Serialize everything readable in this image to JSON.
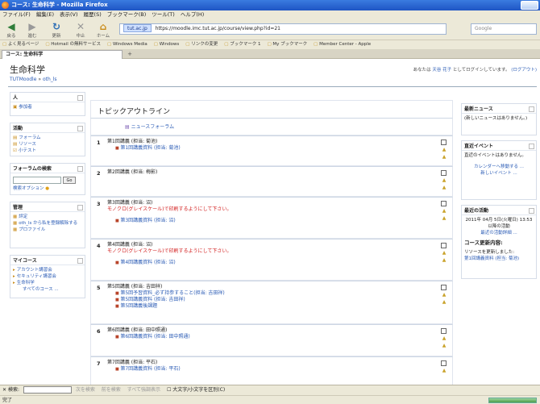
{
  "browser": {
    "title": "コース: 生命科学 - Mozilla Firefox",
    "menu": [
      "ファイル(F)",
      "編集(E)",
      "表示(V)",
      "履歴(S)",
      "ブックマーク(B)",
      "ツール(T)",
      "ヘルプ(H)"
    ],
    "nav": {
      "back": "戻る",
      "forward": "進む",
      "reload": "更新",
      "stop": "中止",
      "home": "ホーム"
    },
    "url_site": "tut.ac.jp",
    "url": "https://moodle.imc.tut.ac.jp/course/view.php?id=21",
    "search_placeholder": "Google",
    "bookmarks": [
      "よく見るページ",
      "Hotmail の無料サービス",
      "Windows Media",
      "Windows",
      "リンクの変更",
      "ブックマーク 1",
      "My ブックマーク",
      "Member Center - Apple"
    ],
    "tab_title": "コース: 生命科学"
  },
  "header": {
    "course_title": "生命科学",
    "login_prefix": "あなたは",
    "user": "天谷 花子",
    "login_suffix": "としてログインしています。",
    "logout": "(ログアウト)"
  },
  "breadcrumb": {
    "root": "TUTMoodle",
    "sep": "»",
    "current": "oth_ls"
  },
  "left": {
    "people": {
      "title": "人",
      "items": [
        "参加者"
      ]
    },
    "activities": {
      "title": "活動",
      "items": [
        "フォーラム",
        "リソース",
        "小テスト"
      ]
    },
    "forum_search": {
      "title": "フォーラムの検索",
      "go": "Go",
      "advanced": "検索オプション"
    },
    "admin": {
      "title": "管理",
      "items": [
        "評定",
        "oth_ls から私を登録解除する",
        "プロファイル"
      ]
    },
    "mycourses": {
      "title": "マイコース",
      "items": [
        "アカウント講習会",
        "セキュリティ講習会",
        "生命科学"
      ],
      "all": "すべてのコース ..."
    }
  },
  "center": {
    "heading": "トピックアウトライン",
    "forum": "ニュースフォーラム",
    "sections": [
      {
        "num": "1",
        "name": "第1回講義 (担当: 菊池)",
        "warn": "",
        "links": [
          "第1回講義資料 (担当: 菊池)"
        ]
      },
      {
        "num": "2",
        "name": "第2回講義 (担当: 梅影)",
        "warn": "",
        "links": []
      },
      {
        "num": "3",
        "name": "第3回講義 (担当: 沼)",
        "warn": "モノクロ(グレイスケール)で印刷するようにして下さい。",
        "links": [
          "第3回講義資料 (担当: 沼)"
        ]
      },
      {
        "num": "4",
        "name": "第4回講義 (担当: 沼)",
        "warn": "モノクロ(グレイスケール)で印刷するようにして下さい。",
        "links": [
          "第4回講義資料 (担当: 沼)"
        ]
      },
      {
        "num": "5",
        "name": "第5回講義 (担当: 吉田祥)",
        "warn": "",
        "links": [
          "第5回予習資料_必ず持参すること(担当: 吉田祥)",
          "第5回講義資料 (担当: 吉田祥)",
          "第5回講義後課題"
        ]
      },
      {
        "num": "6",
        "name": "第6回講義 (担当: 田中照通)",
        "warn": "",
        "links": [
          "第6回講義資料 (担当: 田中照通)"
        ]
      },
      {
        "num": "7",
        "name": "第7回講義 (担当: 平石)",
        "warn": "",
        "links": [
          "第7回講義資料 (担当: 平石)"
        ]
      }
    ]
  },
  "right": {
    "news": {
      "title": "最新ニュース",
      "body": "(新しいニュースはありません。)"
    },
    "events": {
      "title": "直近イベント",
      "body": "直近のイベントはありません。",
      "calendar": "カレンダーへ移動する ...",
      "new_event": "新しいイベント ..."
    },
    "recent": {
      "title": "最近の活動",
      "date": "2011年 04月 5日(火曜日) 13:53 以降の活動",
      "full": "最近の活動詳細 ...",
      "updates_title": "コース更新内容:",
      "updated": "リソースを更新しました:",
      "link": "第1回講義資料 (担当: 菊池)"
    }
  },
  "findbar": {
    "label": "検索:",
    "next": "次を検索",
    "prev": "前を検索",
    "highlight": "すべて強調表示",
    "match_case": "大文字/小文字を区別(C)"
  },
  "status": {
    "text": "完了"
  }
}
